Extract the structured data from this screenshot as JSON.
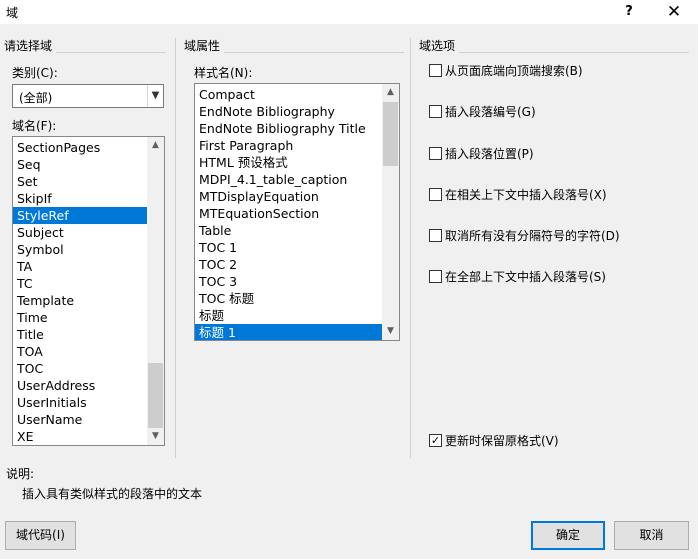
{
  "window": {
    "title": "域",
    "help_glyph": "?",
    "close_glyph": "✕"
  },
  "left": {
    "group_title": "请选择域",
    "category_label": "类别(C):",
    "category_value": "(全部)",
    "field_names_label": "域名(F):",
    "field_names": [
      "SectionPages",
      "Seq",
      "Set",
      "SkipIf",
      "StyleRef",
      "Subject",
      "Symbol",
      "TA",
      "TC",
      "Template",
      "Time",
      "Title",
      "TOA",
      "TOC",
      "UserAddress",
      "UserInitials",
      "UserName",
      "XE"
    ],
    "selected_field": "StyleRef"
  },
  "middle": {
    "group_title": "域属性",
    "style_name_label": "样式名(N):",
    "styles": [
      "Compact",
      "EndNote Bibliography",
      "EndNote Bibliography Title",
      "First Paragraph",
      "HTML 预设格式",
      "MDPI_4.1_table_caption",
      "MTDisplayEquation",
      "MTEquationSection",
      "Table",
      "TOC 1",
      "TOC 2",
      "TOC 3",
      "TOC 标题",
      "标题",
      "标题 1"
    ],
    "selected_style": "标题 1"
  },
  "right": {
    "group_title": "域选项",
    "options": [
      {
        "label": "从页面底端向顶端搜索(B)",
        "checked": false
      },
      {
        "label": "插入段落编号(G)",
        "checked": false
      },
      {
        "label": "插入段落位置(P)",
        "checked": false
      },
      {
        "label": "在相关上下文中插入段落号(X)",
        "checked": false
      },
      {
        "label": "取消所有没有分隔符号的字符(D)",
        "checked": false
      },
      {
        "label": "在全部上下文中插入段落号(S)",
        "checked": false
      }
    ],
    "preserve_format": {
      "label": "更新时保留原格式(V)",
      "checked": true
    }
  },
  "description": {
    "label": "说明:",
    "text": "插入具有类似样式的段落中的文本"
  },
  "buttons": {
    "field_codes": "域代码(I)",
    "ok": "确定",
    "cancel": "取消"
  },
  "icons": {
    "check": "✓",
    "arrow_up": "▲",
    "arrow_down": "▼",
    "chevron_down": "⌄"
  }
}
